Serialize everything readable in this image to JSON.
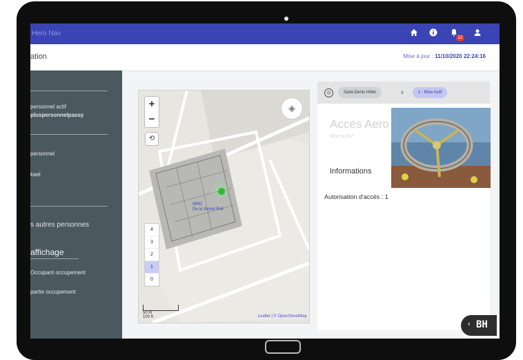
{
  "appbar": {
    "brand": "Hero Nav",
    "icons": [
      "home-icon",
      "info-icon",
      "bell-icon",
      "user-icon"
    ],
    "notification_count": "12",
    "color": "#3a44b4"
  },
  "header": {
    "title": "ation",
    "when_prefix": "Mise à jour :",
    "when_value": "11/10/2020 22:24:16"
  },
  "sidebar": {
    "items": [
      {
        "line1": "personnel actif",
        "line2": "pluspersonnelpassy"
      },
      {
        "line1": "personnel"
      },
      {
        "line1": "kael"
      },
      {
        "line1": "s autres personnes"
      }
    ],
    "section_title": "affichage",
    "section_items": [
      "Occupant occupement",
      "partie occupement"
    ]
  },
  "map": {
    "zoom_in": "+",
    "zoom_out": "−",
    "rotate": "⟲",
    "layers": "◈",
    "floors": [
      "4",
      "3",
      "2",
      "1",
      "0"
    ],
    "selected_floor": "1",
    "scale_top": "50 m",
    "scale_bottom": "100 ft",
    "label_line1": "WRD",
    "label_line2": "De la Vanne Roll",
    "attribution": "Leaflet | © OpenStreetMap"
  },
  "details": {
    "crumbs": [
      "Saint-Denis Hôtel",
      "1 - Mise Actif"
    ],
    "title": "Accès Aero",
    "subtitle": "Mise à jour",
    "info_heading": "Informations",
    "info_line": "Autorisation d'accès : 1"
  },
  "overlay": {
    "bh_label": "BH",
    "bh_chevron": "‹"
  }
}
